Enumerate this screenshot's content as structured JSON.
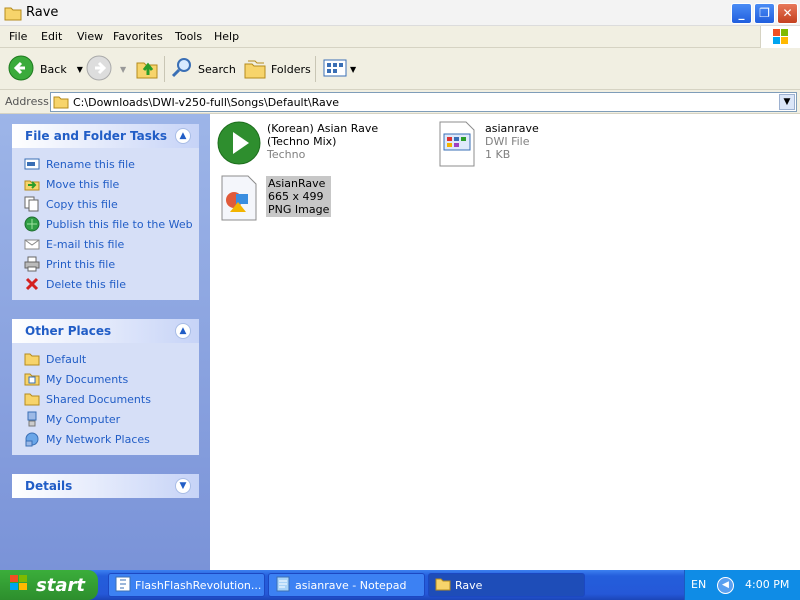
{
  "window": {
    "title": "Rave",
    "min_label": "_",
    "max_label": "❐",
    "close_label": "✕"
  },
  "menu": [
    "File",
    "Edit",
    "View",
    "Favorites",
    "Tools",
    "Help"
  ],
  "toolbar": {
    "back_label": "Back",
    "search_label": "Search",
    "folders_label": "Folders"
  },
  "address": {
    "label": "Address",
    "path": "C:\\Downloads\\DWI-v250-full\\Songs\\Default\\Rave"
  },
  "file_tasks": {
    "title": "File and Folder Tasks",
    "items": [
      {
        "label": "Rename this file",
        "icon": "rename-icon"
      },
      {
        "label": "Move this file",
        "icon": "move-icon"
      },
      {
        "label": "Copy this file",
        "icon": "copy-icon"
      },
      {
        "label": "Publish this file to the Web",
        "icon": "publish-icon"
      },
      {
        "label": "E-mail this file",
        "icon": "email-icon"
      },
      {
        "label": "Print this file",
        "icon": "print-icon"
      },
      {
        "label": "Delete this file",
        "icon": "delete-icon"
      }
    ]
  },
  "other_places": {
    "title": "Other Places",
    "items": [
      {
        "label": "Default",
        "icon": "folder-icon"
      },
      {
        "label": "My Documents",
        "icon": "my-documents-icon"
      },
      {
        "label": "Shared Documents",
        "icon": "folder-icon"
      },
      {
        "label": "My Computer",
        "icon": "computer-icon"
      },
      {
        "label": "My Network Places",
        "icon": "network-icon"
      }
    ]
  },
  "details": {
    "title": "Details"
  },
  "files": [
    {
      "name": "(Korean) Asian Rave (Techno Mix)",
      "sub1": "Techno",
      "sub2": "",
      "icon": "media-play-icon"
    },
    {
      "name": "asianrave",
      "sub1": "DWI File",
      "sub2": "1 KB",
      "icon": "dwi-file-icon"
    },
    {
      "name": "AsianRave",
      "sub1": "665 x 499",
      "sub2": "PNG Image",
      "icon": "png-image-icon"
    }
  ],
  "taskbar": {
    "start_label": "start",
    "buttons": [
      {
        "label": "FlashFlashRevolution..."
      },
      {
        "label": "asianrave - Notepad"
      },
      {
        "label": "Rave"
      }
    ],
    "lang": "EN",
    "time": "4:00 PM"
  },
  "colors": {
    "link_blue": "#215DC6",
    "panel_bg": "#D6DFF7",
    "selection": "#C7C7C7"
  }
}
